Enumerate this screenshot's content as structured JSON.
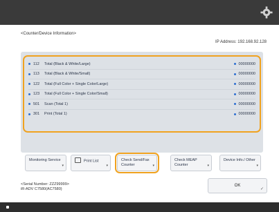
{
  "header": {
    "settings_icon": "gear-icon"
  },
  "screen": {
    "title": "<Counter/Device Information>",
    "ip_address": "IP Address: 192.168.92.128"
  },
  "counters": [
    {
      "num": "112",
      "label": "Total (Black & White/Large)",
      "value": "00000000"
    },
    {
      "num": "113",
      "label": "Total (Black & White/Small)",
      "value": "00000000"
    },
    {
      "num": "122",
      "label": "Total (Full Color + Single Color/Large)",
      "value": "00000000"
    },
    {
      "num": "123",
      "label": "Total (Full Color + Single Color/Small)",
      "value": "00000000"
    },
    {
      "num": "501",
      "label": "Scan (Total 1)",
      "value": "00000000"
    },
    {
      "num": "301",
      "label": "Print (Total 1)",
      "value": "00000000"
    }
  ],
  "buttons": {
    "monitoring_service": "Monitoring Service",
    "print_list": "Print List",
    "check_send_fax": "Check Send/Fax Counter",
    "check_mead": "Check MEAP Counter",
    "device_info": "Device Info./ Other",
    "ok": "OK"
  },
  "device": {
    "serial": "<Serial Number: ZZZ99999>",
    "model": "iR-ADV C7580(AC7580)"
  },
  "colors": {
    "highlight": "#f0a21f",
    "accent": "#2e6fd0"
  }
}
